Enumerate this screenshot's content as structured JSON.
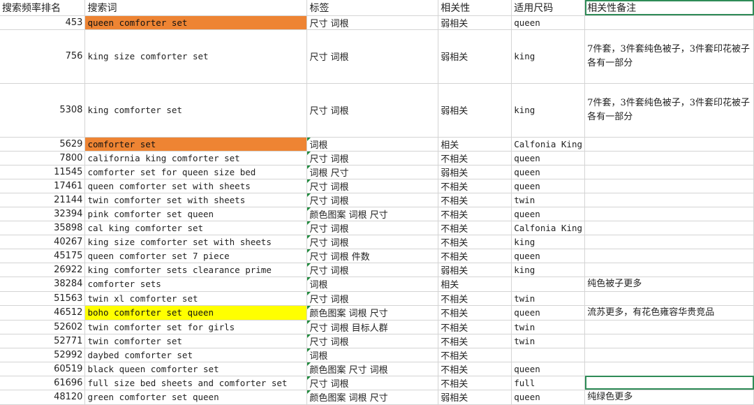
{
  "headers": [
    "搜索频率排名",
    "搜索词",
    "标签",
    "相关性",
    "适用尺码",
    "相关性备注"
  ],
  "rows": [
    {
      "rank": "453",
      "keyword": "queen comforter set",
      "tag": "尺寸 词根",
      "relevance": "弱相关",
      "size": "queen",
      "note": "",
      "height": 19,
      "hl": "orange"
    },
    {
      "rank": "756",
      "keyword": "king size comforter set",
      "tag": "尺寸  词根",
      "relevance": "弱相关",
      "size": "king",
      "note": "7件套，3件套纯色被子，3件套印花被子各有一部分",
      "height": 77,
      "hl": ""
    },
    {
      "rank": "5308",
      "keyword": "king comforter set",
      "tag": "尺寸 词根",
      "relevance": "弱相关",
      "size": "king",
      "note": "7件套，3件套纯色被子，3件套印花被子各有一部分",
      "height": 77,
      "hl": ""
    },
    {
      "rank": "5629",
      "keyword": "comforter set",
      "tag": "词根",
      "relevance": "相关",
      "size": "Calfonia King",
      "note": "",
      "height": 20,
      "hl": "orange"
    },
    {
      "rank": "7800",
      "keyword": "california king comforter set",
      "tag": " 尺寸 词根",
      "relevance": "不相关",
      "size": "queen",
      "note": "",
      "height": 19,
      "hl": ""
    },
    {
      "rank": "11545",
      "keyword": "comforter set for queen size bed",
      "tag": "词根   尺寸",
      "relevance": "弱相关",
      "size": "queen",
      "note": "",
      "height": 19,
      "hl": ""
    },
    {
      "rank": "17461",
      "keyword": "queen comforter set with sheets",
      "tag": "尺寸 词根",
      "relevance": "不相关",
      "size": "queen",
      "note": "",
      "height": 19,
      "hl": ""
    },
    {
      "rank": "21144",
      "keyword": "twin comforter set with sheets",
      "tag": "尺寸 词根",
      "relevance": "不相关",
      "size": "twin",
      "note": "",
      "height": 19,
      "hl": ""
    },
    {
      "rank": "32394",
      "keyword": "pink comforter set queen",
      "tag": "颜色图案 词根  尺寸",
      "relevance": "不相关",
      "size": "queen",
      "note": "",
      "height": 19,
      "hl": ""
    },
    {
      "rank": "35898",
      "keyword": "cal king comforter set",
      "tag": " 尺寸 词根",
      "relevance": "不相关",
      "size": "Calfonia King",
      "note": "",
      "height": 19,
      "hl": ""
    },
    {
      "rank": "40267",
      "keyword": "king size comforter set with sheets",
      "tag": "尺寸  词根",
      "relevance": "不相关",
      "size": "king",
      "note": "",
      "height": 19,
      "hl": ""
    },
    {
      "rank": "45175",
      "keyword": "queen comforter set 7 piece",
      "tag": "尺寸 词根   件数",
      "relevance": "不相关",
      "size": "queen",
      "note": "",
      "height": 19,
      "hl": ""
    },
    {
      "rank": "26922",
      "keyword": "king comforter sets clearance prime",
      "tag": "尺寸 词根",
      "relevance": "弱相关",
      "size": "king",
      "note": "",
      "height": 19,
      "hl": ""
    },
    {
      "rank": "38284",
      "keyword": "comforter sets",
      "tag": "词根",
      "relevance": "相关",
      "size": "",
      "note": "纯色被子更多",
      "height": 19,
      "hl": ""
    },
    {
      "rank": "51563",
      "keyword": "twin xl comforter set",
      "tag": "尺寸  词根",
      "relevance": "不相关",
      "size": "twin",
      "note": "",
      "height": 19,
      "hl": ""
    },
    {
      "rank": "46512",
      "keyword": "boho comforter set queen",
      "tag": "颜色图案 词根  尺寸",
      "relevance": "不相关",
      "size": "queen",
      "note": "流苏更多，有花色雍容华贵竞品",
      "height": 19,
      "hl": "yellow"
    },
    {
      "rank": "52602",
      "keyword": "twin comforter set for girls",
      "tag": "尺寸 词根   目标人群",
      "relevance": "不相关",
      "size": "twin",
      "note": "",
      "height": 19,
      "hl": ""
    },
    {
      "rank": "52771",
      "keyword": "twin comforter set",
      "tag": "尺寸 词根",
      "relevance": "不相关",
      "size": "twin",
      "note": "",
      "height": 19,
      "hl": ""
    },
    {
      "rank": "52992",
      "keyword": "daybed comforter set",
      "tag": " 词根",
      "relevance": "不相关",
      "size": "",
      "note": "",
      "height": 19,
      "hl": ""
    },
    {
      "rank": "60519",
      "keyword": "black queen comforter set",
      "tag": "颜色图案 尺寸 词根",
      "relevance": "不相关",
      "size": "queen",
      "note": "",
      "height": 19,
      "hl": ""
    },
    {
      "rank": "61696",
      "keyword": "full size bed sheets and comforter set",
      "tag": "尺寸      词根",
      "relevance": "不相关",
      "size": "full",
      "note": "",
      "height": 19,
      "hl": "",
      "selected": true
    },
    {
      "rank": "48120",
      "keyword": "green comforter set queen",
      "tag": "颜色图案 词根  尺寸",
      "relevance": "弱相关",
      "size": "queen",
      "note": "纯绿色更多",
      "height": 19,
      "hl": ""
    }
  ]
}
